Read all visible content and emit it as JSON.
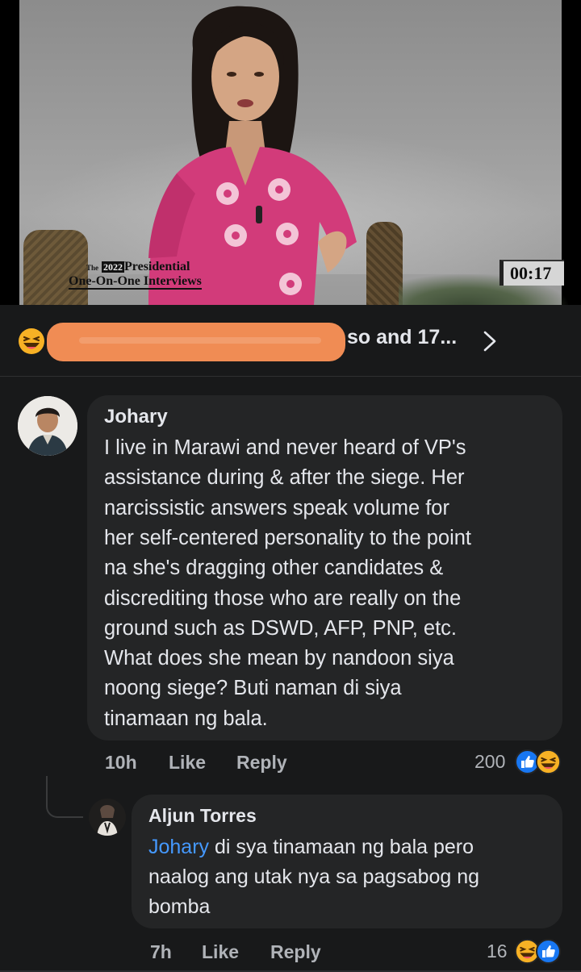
{
  "video": {
    "logo_the": "The",
    "logo_year": "2022",
    "logo_line1": "Presidential",
    "logo_line2": "One-On-One Interviews",
    "timer": "00:17"
  },
  "reactions_bar": {
    "text": "so and 17...",
    "icon": "haha-emoji-icon"
  },
  "comment": {
    "author": "Johary",
    "lines": [
      "I live in Marawi and never heard of VP's",
      "assistance during & after the siege. Her",
      "narcissistic answers speak volume for",
      "her self-centered personality to the point",
      "na she's dragging other candidates &",
      "discrediting those who are really on the",
      "ground such as DSWD, AFP, PNP, etc.",
      "What does she mean by nandoon siya",
      "noong siege? Buti naman di siya",
      "tinamaan ng bala."
    ],
    "time": "10h",
    "like_label": "Like",
    "reply_label": "Reply",
    "reaction_count": "200",
    "reaction_icons": [
      "like-icon",
      "haha-emoji-icon"
    ]
  },
  "reply": {
    "author": "Aljun Torres",
    "mention": "Johary",
    "line1_rest": " di sya tinamaan ng bala pero",
    "line2": "naalog ang utak nya sa pagsabog ng",
    "line3": "bomba",
    "time": "7h",
    "like_label": "Like",
    "reply_label": "Reply",
    "reaction_count": "16",
    "reaction_icons": [
      "haha-emoji-icon",
      "like-icon"
    ]
  },
  "colors": {
    "background": "#18191a",
    "bubble": "#242526",
    "text": "#e4e6eb",
    "secondary": "#b0b3b8",
    "mention": "#4599ff",
    "like_blue": "#1877f2",
    "haha_yellow": "#f7b125",
    "censor_orange": "#f08c54"
  }
}
